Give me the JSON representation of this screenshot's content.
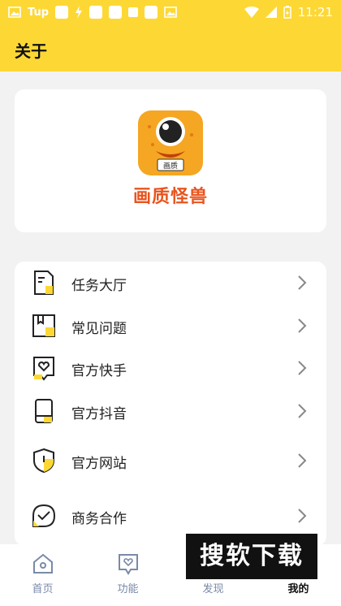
{
  "status_bar": {
    "carrier_text": "Tup",
    "time": "11:21"
  },
  "header": {
    "title": "关于"
  },
  "about": {
    "app_name": "画质怪兽",
    "logo_badge": "画质"
  },
  "menu": {
    "items": [
      {
        "label": "任务大厅",
        "icon": "task-hall-icon"
      },
      {
        "label": "常见问题",
        "icon": "faq-book-icon"
      },
      {
        "label": "官方快手",
        "icon": "kuaishou-heart-icon"
      },
      {
        "label": "官方抖音",
        "icon": "douyin-phone-icon"
      },
      {
        "label": "官方网站",
        "icon": "shield-icon"
      },
      {
        "label": "商务合作",
        "icon": "chat-bubble-icon"
      }
    ]
  },
  "bottom_nav": {
    "tabs": [
      {
        "label": "首页",
        "icon": "home-icon"
      },
      {
        "label": "功能",
        "icon": "function-icon"
      },
      {
        "label": "发现",
        "icon": "discover-icon"
      },
      {
        "label": "我的",
        "icon": "profile-icon"
      }
    ],
    "active_index": 3
  },
  "watermark": {
    "text": "搜软下载"
  },
  "colors": {
    "accent_yellow": "#fdd835",
    "brand_orange": "#e8541e"
  }
}
